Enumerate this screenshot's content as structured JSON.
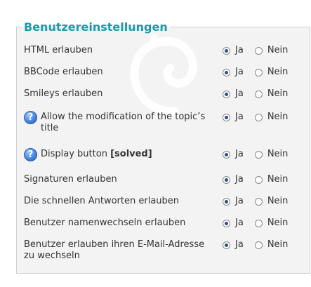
{
  "panel": {
    "title": "Benutzereinstellungen",
    "option_yes": "Ja",
    "option_no": "Nein",
    "help_glyph": "?",
    "rows": [
      {
        "label": "HTML erlauben",
        "selected": "yes",
        "help_icon": false
      },
      {
        "label": "BBCode erlauben",
        "selected": "yes",
        "help_icon": false
      },
      {
        "label": "Smileys erlauben",
        "selected": "yes",
        "help_icon": false
      },
      {
        "label": "Allow the modification of the topic’s title",
        "selected": "yes",
        "help_icon": true
      },
      {
        "label": "Display button [solved]",
        "label_plain": "Display button",
        "label_bold": "[solved]",
        "selected": "yes",
        "help_icon": true
      },
      {
        "label": "Signaturen erlauben",
        "selected": "yes",
        "help_icon": false
      },
      {
        "label": "Die schnellen Antworten erlauben",
        "selected": "yes",
        "help_icon": false
      },
      {
        "label": "Benutzer namenwechseln erlauben",
        "selected": "yes",
        "help_icon": false
      },
      {
        "label": "Benutzer erlauben ihren E-Mail-Adresse zu wechseln",
        "selected": "yes",
        "help_icon": false
      }
    ]
  },
  "colors": {
    "title": "#1b9aaa",
    "panel_bg": "#f3f3f3",
    "radio_dot": "#2d4c8c"
  }
}
